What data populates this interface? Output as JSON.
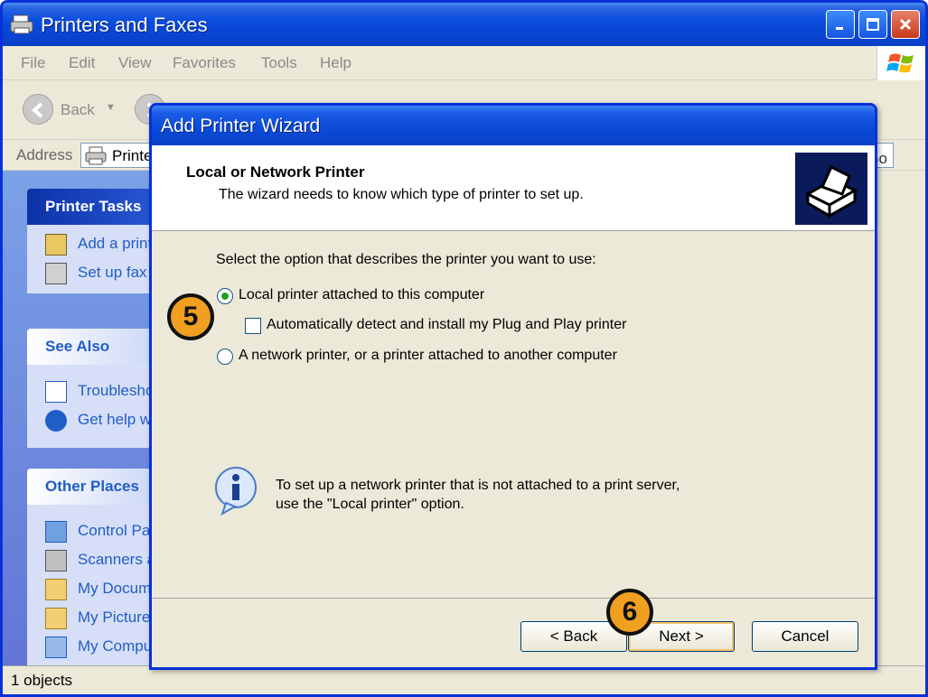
{
  "window": {
    "title": "Printers and Faxes",
    "menu": [
      "File",
      "Edit",
      "View",
      "Favorites",
      "Tools",
      "Help"
    ],
    "toolbar": {
      "back_label": "Back"
    },
    "address": {
      "label": "Address",
      "value": "Printe",
      "go_label": "Go"
    },
    "status": "1 objects"
  },
  "sidebar": {
    "printer_tasks": {
      "title": "Printer Tasks",
      "items": [
        "Add a print",
        "Set up fax"
      ]
    },
    "see_also": {
      "title": "See Also",
      "items": [
        "Troublesho",
        "Get help w"
      ]
    },
    "other_places": {
      "title": "Other Places",
      "items": [
        "Control Pa",
        "Scanners a",
        "My Docume",
        "My Picture",
        "My Compu"
      ]
    }
  },
  "wizard": {
    "title": "Add Printer Wizard",
    "header_title": "Local or Network Printer",
    "header_subtitle": "The wizard needs to know which type of printer to set up.",
    "prompt": "Select the option that describes the printer you want to use:",
    "option_local": "Local printer attached to this computer",
    "option_autodetect": "Automatically detect and install my Plug and Play printer",
    "option_network": "A network printer, or a printer attached to another computer",
    "info_line1": "To set up a network printer that is not attached to a print server,",
    "info_line2": "use the \"Local printer\" option.",
    "back_label": "< Back",
    "next_label": "Next >",
    "cancel_label": "Cancel"
  },
  "badges": {
    "step5": "5",
    "step6": "6"
  },
  "colors": {
    "titlebar": "#0a4de0",
    "frame": "#0831d9",
    "badge": "#f0a020",
    "link": "#215dc6"
  }
}
